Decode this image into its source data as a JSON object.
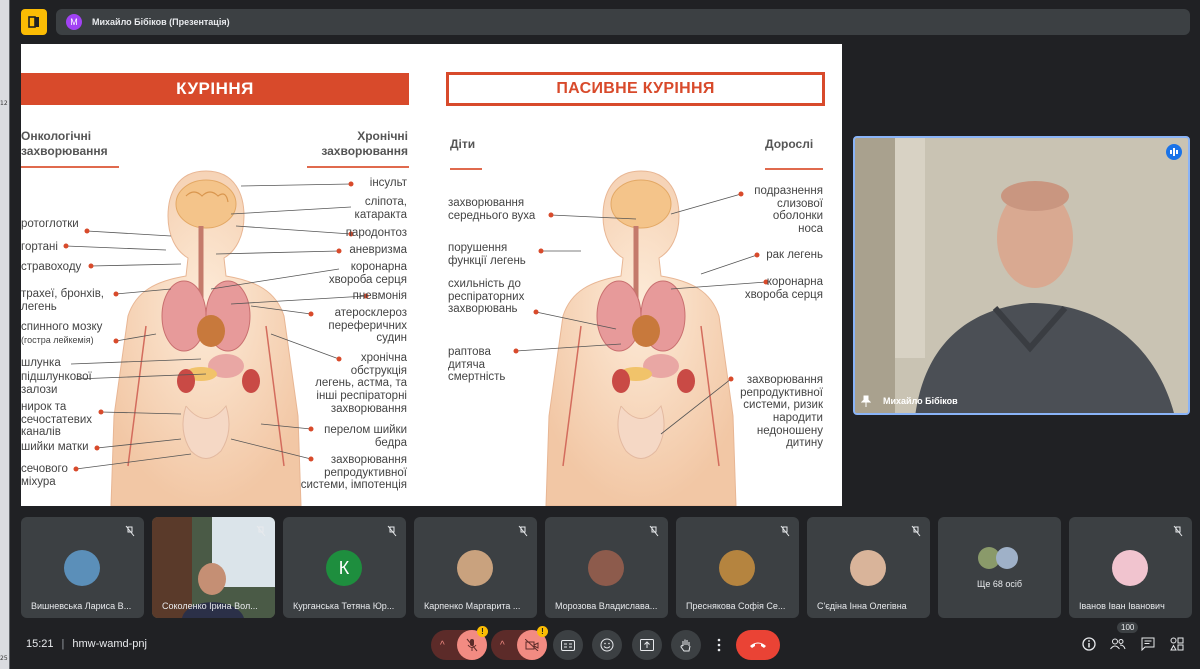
{
  "presenter": {
    "avatar_letter": "М",
    "title": "Михайло Бібіков (Презентація)"
  },
  "slide": {
    "smoking_title": "КУРІННЯ",
    "passive_title": "ПАСИВНЕ КУРІННЯ",
    "onco_heading": [
      "Онкологічні",
      "захворювання"
    ],
    "chronic_heading": [
      "Хронічні",
      "захворювання"
    ],
    "children_heading": "Діти",
    "adults_heading": "Дорослі",
    "onco_items": [
      "ротоглотки",
      "гортані",
      "стравоходу",
      "трахеї, бронхів,",
      "легень",
      "спинного мозку",
      "(гостра лейкемія)",
      "шлунка",
      "підшлункової",
      "залози",
      "нирок та",
      "сечостатевих",
      "каналів",
      "шийки матки",
      "сечового",
      "міхура"
    ],
    "chronic_items": [
      "інсульт",
      "сліпота,",
      "катаракта",
      "пародонтоз",
      "аневризма",
      "коронарна",
      "хвороба серця",
      "пневмонія",
      "атеросклероз",
      "переферичних",
      "судин",
      "хронічна",
      "обструкція",
      "легень, астма, та",
      "інші респіраторні",
      "захворювання",
      "перелом шийки",
      "бедра",
      "захворювання",
      "репродуктивної",
      "системи, імпотенція"
    ],
    "children_items": [
      "захворювання",
      "середнього вуха",
      "порушення",
      "функції легень",
      "схильність до",
      "респіраторних",
      "захворювань",
      "раптова",
      "дитяча",
      "смертність"
    ],
    "adult_items": [
      "подразнення",
      "слизової",
      "оболонки",
      "носа",
      "рак легень",
      "коронарна",
      "хвороба серця",
      "захворювання",
      "репродуктивної",
      "системи, ризик",
      "народити",
      "недоношену",
      "дитину"
    ]
  },
  "self_view": {
    "name": "Михайло Бібіков"
  },
  "participants": [
    {
      "name": "Вишневська Лариса В...",
      "avatar_color": "#5b8fb9",
      "muted": true
    },
    {
      "name": "Соколенко Ірина Вол...",
      "avatar_color": "#6b7f5a",
      "muted": true,
      "video": true
    },
    {
      "name": "Курганська Тетяна Юр...",
      "avatar_letter": "К",
      "avatar_color": "#1e8e3e",
      "muted": true
    },
    {
      "name": "Карпенко Маргарита ...",
      "avatar_color": "#c9a27e",
      "muted": true
    },
    {
      "name": "Морозова Владиславa...",
      "avatar_color": "#8d5b4c",
      "muted": true
    },
    {
      "name": "Преснякова Софія Се...",
      "avatar_color": "#b5843f",
      "muted": true
    },
    {
      "name": "С'єдіна Інна Олегівна",
      "avatar_color": "#d9b49a",
      "muted": true
    },
    {
      "more_text": "Ще 68 осіб",
      "muted": false
    },
    {
      "name": "Іванов Іван Іванович",
      "avatar_color": "#f1c4cf",
      "muted": true
    }
  ],
  "bottom": {
    "time": "15:21",
    "meeting_code": "hmw-wamd-pnj",
    "participant_count": "100",
    "warning_glyph": "!"
  },
  "colors": {
    "accent_red": "#d84a2b",
    "end_call": "#ea4335",
    "speaking_blue": "#1a73e8"
  }
}
